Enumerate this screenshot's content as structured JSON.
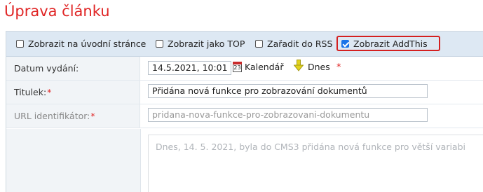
{
  "page": {
    "title": "Úprava článku"
  },
  "options": [
    {
      "label": "Zobrazit na úvodní stránce",
      "checked": false
    },
    {
      "label": "Zobrazit jako TOP",
      "checked": false
    },
    {
      "label": "Zařadit do RSS",
      "checked": false
    },
    {
      "label": "Zobrazit AddThis",
      "checked": true
    }
  ],
  "fields": {
    "date": {
      "label": "Datum vydání:",
      "value": "14.5.2021, 10:01",
      "calendar_label": "Kalendář",
      "calendar_icon_text": "23",
      "today_label": "Dnes",
      "required_mark": "*"
    },
    "title": {
      "label": "Titulek:",
      "required_mark": "*",
      "value": "Přidána nová funkce pro zobrazování dokumentů"
    },
    "url": {
      "label": "URL identifikátor:",
      "required_mark": "*",
      "value": "pridana-nova-funkce-pro-zobrazovani-dokumentu"
    },
    "body": {
      "value": "Dnes, 14. 5. 2021, byla do CMS3 přidána nová funkce pro větší variabi"
    }
  },
  "colors": {
    "accent_red": "#e02525",
    "option_bar": "#dde8f3",
    "checkbox_checked": "#1a73e8",
    "arrow_yellow": "#e2d31e"
  },
  "icons": {
    "calendar": "calendar-icon",
    "today": "down-arrow-icon"
  }
}
